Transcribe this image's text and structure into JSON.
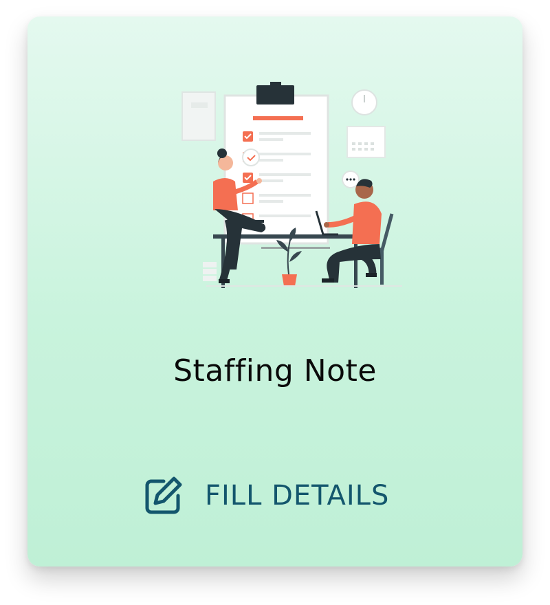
{
  "card": {
    "title": "Staffing Note",
    "action_label": "FILL DETAILS",
    "action_icon": "edit-icon",
    "illustration": "checklist-illustration"
  },
  "colors": {
    "card_top": "#e4f9ef",
    "card_bottom": "#bff0d6",
    "accent": "#f46f52",
    "action_text": "#13566d",
    "dark": "#263238"
  }
}
